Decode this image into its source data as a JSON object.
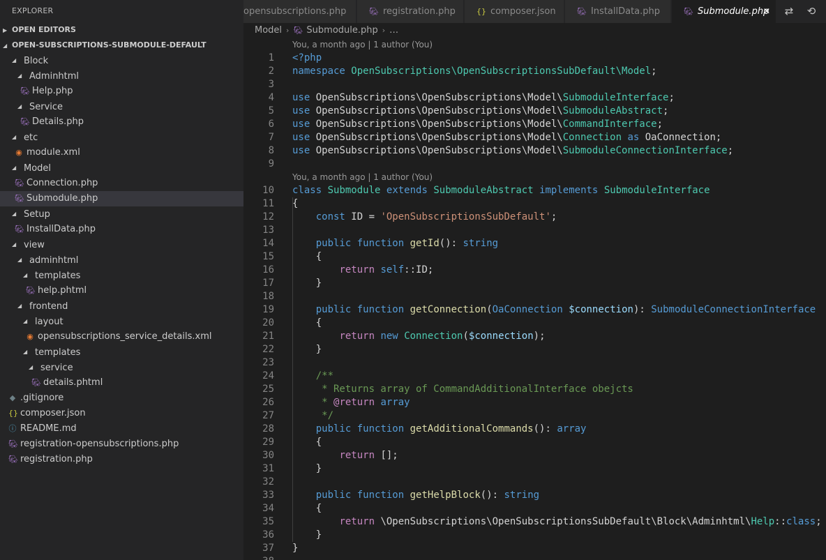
{
  "explorer": {
    "title": "EXPLORER",
    "sections": {
      "open_editors": "OPEN EDITORS",
      "project": "OPEN-SUBSCRIPTIONS-SUBMODULE-DEFAULT"
    },
    "tree": [
      {
        "label": "Block",
        "type": "folder",
        "depth": 0
      },
      {
        "label": "Adminhtml",
        "type": "folder",
        "depth": 1
      },
      {
        "label": "Help.php",
        "type": "php",
        "depth": 2
      },
      {
        "label": "Service",
        "type": "folder",
        "depth": 1
      },
      {
        "label": "Details.php",
        "type": "php",
        "depth": 2
      },
      {
        "label": "etc",
        "type": "folder",
        "depth": 0
      },
      {
        "label": "module.xml",
        "type": "xml",
        "depth": 1
      },
      {
        "label": "Model",
        "type": "folder",
        "depth": 0
      },
      {
        "label": "Connection.php",
        "type": "php",
        "depth": 1
      },
      {
        "label": "Submodule.php",
        "type": "php",
        "depth": 1,
        "selected": true
      },
      {
        "label": "Setup",
        "type": "folder",
        "depth": 0
      },
      {
        "label": "InstallData.php",
        "type": "php",
        "depth": 1
      },
      {
        "label": "view",
        "type": "folder",
        "depth": 0
      },
      {
        "label": "adminhtml",
        "type": "folder",
        "depth": 1
      },
      {
        "label": "templates",
        "type": "folder",
        "depth": 2
      },
      {
        "label": "help.phtml",
        "type": "php",
        "depth": 3
      },
      {
        "label": "frontend",
        "type": "folder",
        "depth": 1
      },
      {
        "label": "layout",
        "type": "folder",
        "depth": 2
      },
      {
        "label": "opensubscriptions_service_details.xml",
        "type": "xml",
        "depth": 3
      },
      {
        "label": "templates",
        "type": "folder",
        "depth": 2
      },
      {
        "label": "service",
        "type": "folder",
        "depth": 3
      },
      {
        "label": "details.phtml",
        "type": "php",
        "depth": 4
      },
      {
        "label": ".gitignore",
        "type": "git",
        "depth": -1
      },
      {
        "label": "composer.json",
        "type": "json",
        "depth": -1
      },
      {
        "label": "README.md",
        "type": "info",
        "depth": -1
      },
      {
        "label": "registration-opensubscriptions.php",
        "type": "php",
        "depth": -1
      },
      {
        "label": "registration.php",
        "type": "php",
        "depth": -1
      }
    ]
  },
  "tabs": [
    {
      "label": "opensubscriptions.php",
      "icon": "php-elephant-icon"
    },
    {
      "label": "registration.php",
      "icon": "php-elephant-icon"
    },
    {
      "label": "composer.json",
      "icon": "json-braces-icon"
    },
    {
      "label": "InstallData.php",
      "icon": "php-elephant-icon"
    },
    {
      "label": "Submodule.php",
      "icon": "php-elephant-icon",
      "active": true
    }
  ],
  "tab_actions": [
    "compare-changes-icon",
    "open-changes-icon"
  ],
  "breadcrumb": {
    "folder": "Model",
    "file": "Submodule.php",
    "more": "…"
  },
  "code_lens": "You, a month ago | 1 author (You)",
  "icons": {
    "php": "php-elephant-icon",
    "xml": "rss-xml-icon",
    "json": "json-braces-icon",
    "git": "git-diamond-icon",
    "info": "info-circle-icon",
    "folder": "chevron-down-icon"
  },
  "colors": {
    "accent": "#007acc",
    "php_icon": "#a074c4",
    "xml_icon": "#e37933"
  }
}
